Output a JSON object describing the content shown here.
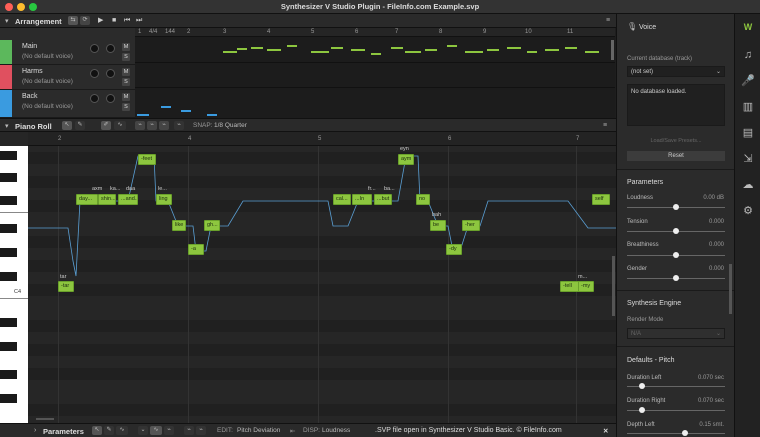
{
  "window": {
    "title": "Synthesizer V Studio Plugin - FileInfo.com Example.svp"
  },
  "arrangement": {
    "label": "Arrangement",
    "ruler": [
      "1",
      "4/4",
      "144",
      "2",
      "3",
      "4",
      "5",
      "6",
      "7",
      "8",
      "9",
      "10",
      "11"
    ],
    "tracks": [
      {
        "name": "Main",
        "voice": "(No default voice)",
        "color": "#5cb85c"
      },
      {
        "name": "Harms",
        "voice": "(No default voice)",
        "color": "#e0505f"
      },
      {
        "name": "Back",
        "voice": "(No default voice)",
        "color": "#3a9be0"
      }
    ]
  },
  "piano_roll": {
    "label": "Piano Roll",
    "snap_label": "SNAP:",
    "snap_value": "1/8 Quarter",
    "ruler": [
      "2",
      "4",
      "5",
      "6",
      "7"
    ],
    "key_label": "C4",
    "notes": [
      {
        "text": "-tar",
        "lyric": "tar"
      },
      {
        "text": "day...",
        "lyric": "axm"
      },
      {
        "text": "shin...",
        "lyric": "ka..."
      },
      {
        "text": "...and...",
        "lyric": "daa"
      },
      {
        "text": "-feet",
        "lyric": ""
      },
      {
        "text": "ling",
        "lyric": "le..."
      },
      {
        "text": "like",
        "lyric": ""
      },
      {
        "text": "-a",
        "lyric": ""
      },
      {
        "text": "gh...",
        "lyric": ""
      },
      {
        "text": "cal...",
        "lyric": ""
      },
      {
        "text": "...In",
        "lyric": "fr..."
      },
      {
        "text": "...but",
        "lyric": "ba..."
      },
      {
        "text": "aym",
        "lyric": "eyn"
      },
      {
        "text": "no",
        "lyric": ""
      },
      {
        "text": "be",
        "lyric": "bah"
      },
      {
        "text": "-dy",
        "lyric": ""
      },
      {
        "text": "-her",
        "lyric": ""
      },
      {
        "text": "self",
        "lyric": ""
      },
      {
        "text": "-tell",
        "lyric": ""
      },
      {
        "text": "-my",
        "lyric": "m..."
      }
    ]
  },
  "parameters_bar": {
    "label": "Parameters",
    "edit_label": "EDIT:",
    "edit_value": "Pitch Deviation",
    "disp_label": "DISP:",
    "disp_value": "Loudness",
    "caption": ".SVP file open in Synthesizer V Studio Basic. © FileInfo.com"
  },
  "voice_panel": {
    "title": "Voice",
    "current_db_label": "Current database (track)",
    "current_db_value": "(not set)",
    "no_db_text": "No database loaded.",
    "load_presets": "Load/Save Presets...",
    "reset": "Reset",
    "parameters_title": "Parameters",
    "params": [
      {
        "label": "Loudness",
        "value": "0.00 dB",
        "level": 0.5
      },
      {
        "label": "Tension",
        "value": "0.000",
        "level": 0.5
      },
      {
        "label": "Breathiness",
        "value": "0.000",
        "level": 0.5
      },
      {
        "label": "Gender",
        "value": "0.000",
        "level": 0.5
      }
    ],
    "synthesis_title": "Synthesis Engine",
    "render_mode_label": "Render Mode",
    "render_mode_value": "N/A",
    "defaults_title": "Defaults - Pitch",
    "defaults": [
      {
        "label": "Duration Left",
        "value": "0.070 sec"
      },
      {
        "label": "Duration Right",
        "value": "0.070 sec"
      },
      {
        "label": "Depth Left",
        "value": "0.15 smt."
      }
    ]
  }
}
